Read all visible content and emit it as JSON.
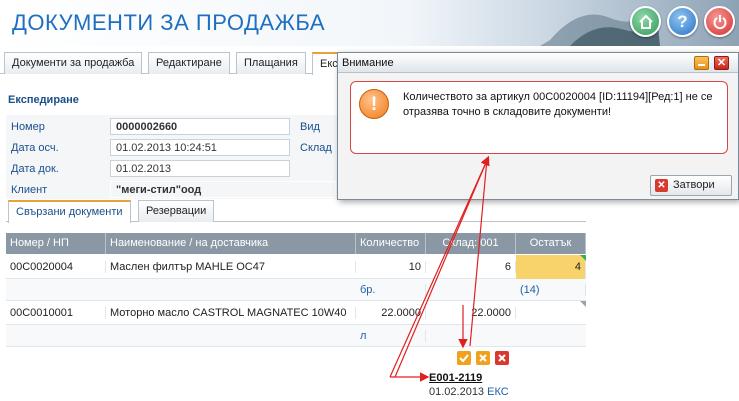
{
  "header": {
    "title": "ДОКУМЕНТИ ЗА ПРОДАЖБА",
    "help_label": "?"
  },
  "tabs": [
    "Документи за продажба",
    "Редактиране",
    "Плащания",
    "Експедиране"
  ],
  "section": {
    "title": "Експедиране"
  },
  "form": {
    "number_label": "Номер",
    "number_value": "0000002660",
    "dateacc_label": "Дата осч.",
    "dateacc_value": "01.02.2013 10:24:51",
    "datedoc_label": "Дата док.",
    "datedoc_value": "01.02.2013",
    "client_label": "Клиент",
    "client_value": "\"меги-стил\"оод",
    "type_label": "Вид",
    "warehouse_label": "Склад"
  },
  "subtabs": [
    "Свързани документи",
    "Резервации"
  ],
  "table": {
    "columns": [
      "Номер / НП",
      "Наименование / на доставчика",
      "Количество",
      "Склад: 001",
      "Остатък"
    ],
    "rows": [
      {
        "code": "00C0020004",
        "name": "Маслен филтър MAHLE OC47",
        "qty": "10",
        "stock": "6",
        "rest": "4",
        "unit": "бр.",
        "rest_sub": "(14)"
      },
      {
        "code": "00C0010001",
        "name": "Моторно масло CASTROL MAGNATEC 10W40",
        "qty": "22.0000",
        "stock": "22.0000",
        "rest": "",
        "unit": "л",
        "rest_sub": ""
      }
    ],
    "doc_number": "E001-2119",
    "doc_date": "01.02.2013",
    "doc_type": "ЕКС"
  },
  "dialog": {
    "title": "Внимание",
    "message": "Количеството за артикул 00C0020004 [ID:11194][Ред:1] не се отразява точно в складовите документи!",
    "close_label": "Затвори",
    "icon_glyph": "!",
    "close_glyph": "✕"
  },
  "colors": {
    "accent": "#1f6fc1",
    "warning": "#f07a1a",
    "danger": "#d83a2f",
    "highlight": "#f8d26a"
  }
}
